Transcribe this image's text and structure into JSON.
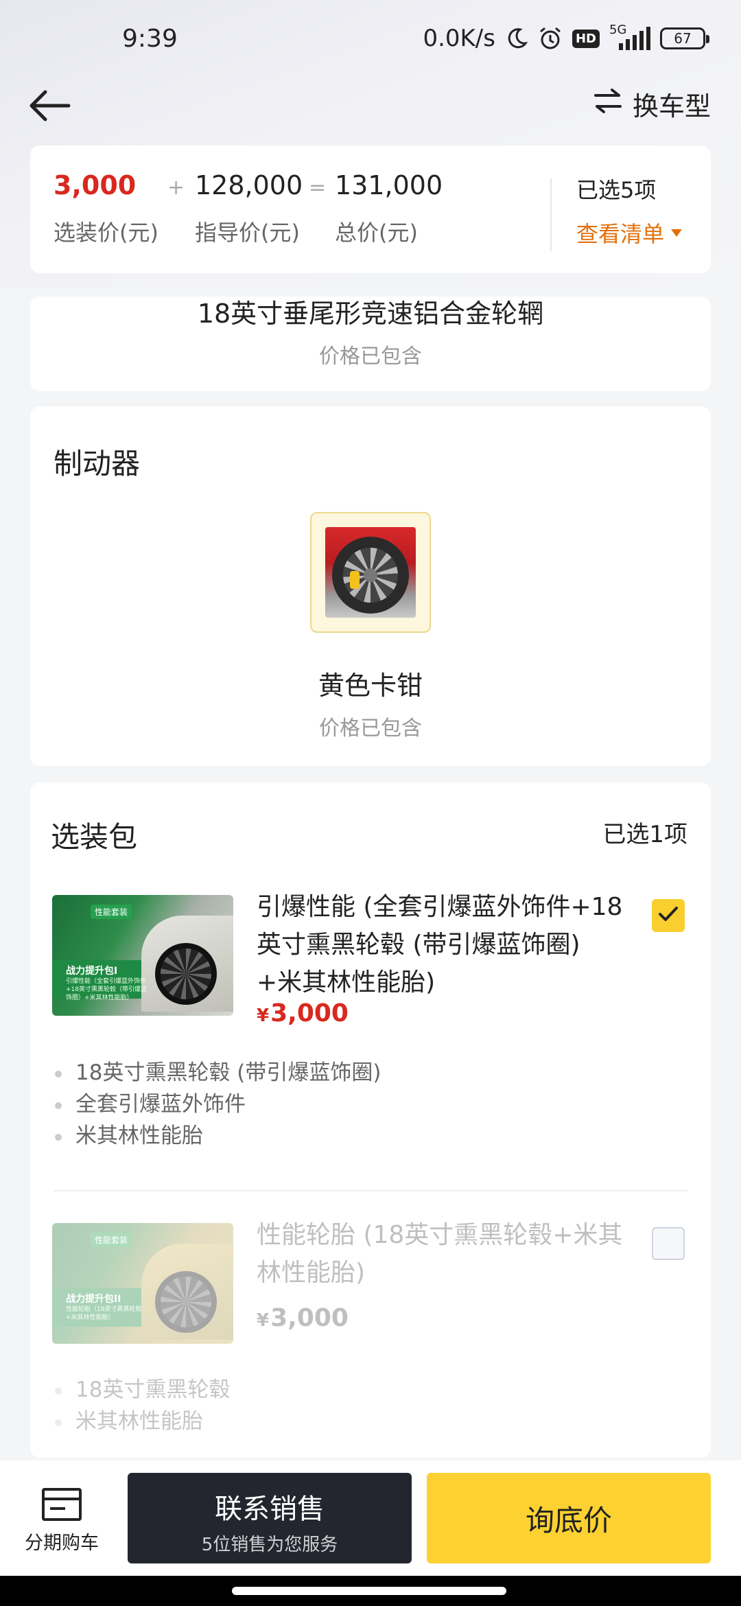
{
  "status_bar": {
    "time": "9:39",
    "speed": "0.0K/s",
    "hd": "HD",
    "network": "5G",
    "battery": "67"
  },
  "nav": {
    "switch_label": "换车型"
  },
  "price_summary": {
    "option_price": "3,000",
    "option_label": "选装价(元)",
    "plus": "+",
    "guide_price": "128,000",
    "guide_label": "指导价(元)",
    "equals": "=",
    "total_price": "131,000",
    "total_label": "总价(元)",
    "selected_count": "已选5项",
    "view_list": "查看清单"
  },
  "wheel_section": {
    "name": "18英寸垂尾形竞速铝合金轮辋",
    "note": "价格已包含"
  },
  "brake_section": {
    "title": "制动器",
    "item_name": "黄色卡钳",
    "item_note": "价格已包含"
  },
  "packages": {
    "title": "选装包",
    "selected_count": "已选1项",
    "items": [
      {
        "name": "引爆性能 (全套引爆蓝外饰件+18英寸熏黑轮毂 (带引爆蓝饰圈) +米其林性能胎)",
        "currency": "¥",
        "price": "3,000",
        "checked": true,
        "image_tag": "性能套装",
        "image_line1": "战力提升包I",
        "image_line2": "引爆性能（全套引爆蓝外饰件+18英寸熏黑轮毂（带引爆蓝饰圈）+米其林性能胎）",
        "features": [
          "18英寸熏黑轮毂 (带引爆蓝饰圈)",
          "全套引爆蓝外饰件",
          "米其林性能胎"
        ]
      },
      {
        "name": "性能轮胎 (18英寸熏黑轮毂+米其林性能胎)",
        "currency": "¥",
        "price": "3,000",
        "checked": false,
        "image_tag": "性能套装",
        "image_line1": "战力提升包II",
        "image_line2": "性能轮胎（18英寸熏黑轮毂+米其林性能胎）",
        "features": [
          "18英寸熏黑轮毂",
          "米其林性能胎"
        ]
      }
    ]
  },
  "bottom_bar": {
    "installment_label": "分期购车",
    "contact_title": "联系销售",
    "contact_sub": "5位销售为您服务",
    "ask_price": "询底价"
  },
  "colors": {
    "accent_red": "#d9281e",
    "accent_orange": "#e3700b",
    "accent_yellow": "#fcd131",
    "dark_button": "#24262f"
  },
  "icons": [
    "back-arrow-icon",
    "swap-icon",
    "chevron-down-icon",
    "check-icon",
    "installment-icon",
    "moon-icon",
    "alarm-icon",
    "signal-icon",
    "battery-icon"
  ]
}
